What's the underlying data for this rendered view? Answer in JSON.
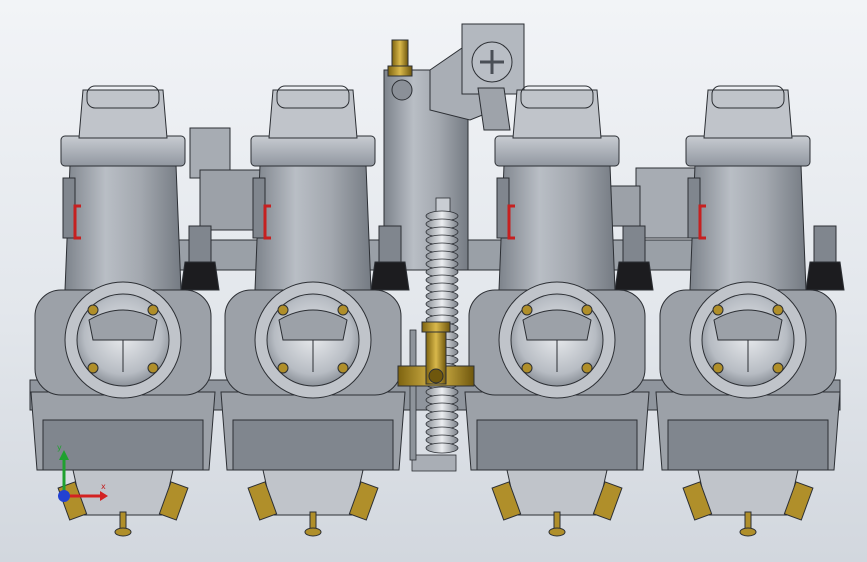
{
  "scene": {
    "background_top": "#f2f4f7",
    "background_bottom": "#d2d7de",
    "carburetor_count": 4,
    "body_color": "#9ca1a8",
    "body_shade": "#80868e",
    "body_light": "#c0c4ca",
    "edge_color": "#2c2f34",
    "brass_color": "#b08f2a",
    "marker_color": "#c62020",
    "rubber_color": "#1c1c1f"
  },
  "triad": {
    "icon": "coordinate-axis-triad",
    "x_axis_color": "#d32222",
    "y_axis_color": "#1fa12f",
    "z_axis_color": "#2241d2"
  }
}
